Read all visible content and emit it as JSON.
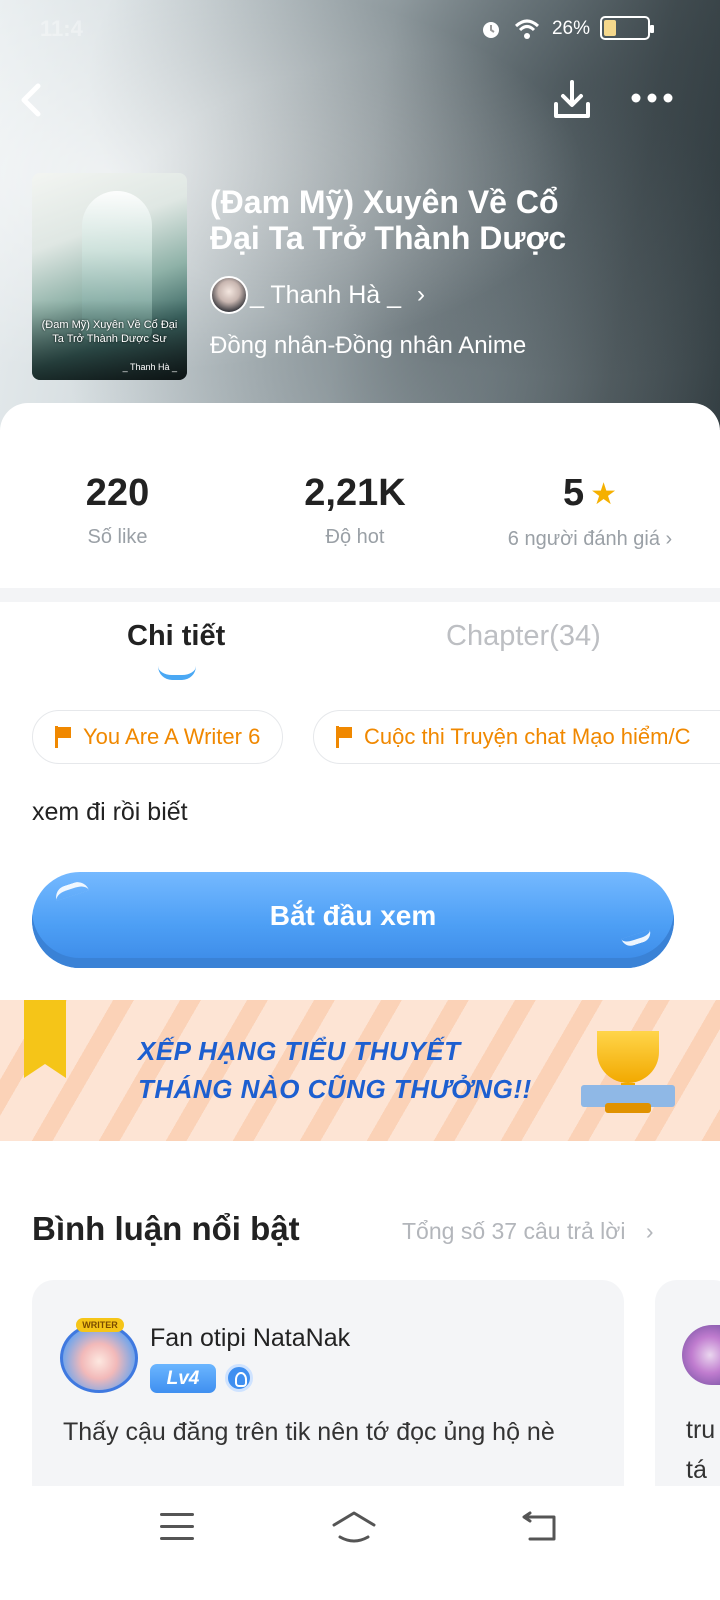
{
  "status_bar": {
    "time": "11:4",
    "battery": "26%"
  },
  "book": {
    "title": "(Đam Mỹ) Xuyên Về Cổ Đại Ta Trở Thành Dược",
    "author": "_ Thanh Hà _",
    "genre": "Đồng nhân-Đồng nhân Anime",
    "cover_title": "(Đam Mỹ) Xuyên Về Cổ Đại Ta Trở Thành Dược Sư",
    "cover_author": "_ Thanh Hà _"
  },
  "stats": {
    "likes_value": "220",
    "likes_label": "Số like",
    "hot_value": "2,21K",
    "hot_label": "Độ hot",
    "rating_value": "5",
    "rating_label": "6 người đánh giá",
    "rating_chevron": "›"
  },
  "tabs": {
    "detail": "Chi tiết",
    "chapter": "Chapter(34)"
  },
  "tags": [
    "You Are A Writer 6",
    "Cuộc thi Truyện chat Mạo hiểm/C"
  ],
  "description": "xem đi rồi biết",
  "start_button": "Bắt đầu xem",
  "banner": {
    "line1": "XẾP HẠNG TIỂU THUYẾT",
    "line2": "THÁNG NÀO CŨNG THƯỞNG!!"
  },
  "comments_section": {
    "title": "Bình luận nổi bật",
    "total": "Tổng số 37 câu trả lời",
    "chevron": "›"
  },
  "comment": {
    "author": "Fan otipi NataNak",
    "writer_badge": "WRITER",
    "level": "Lv4",
    "text": "Thấy cậu đăng trên tik nên tớ đọc ủng hộ nè"
  },
  "next_comment": {
    "line1": "tru",
    "line2": "tá"
  },
  "colors": {
    "accent": "#4aa8f4",
    "tag_orange": "#f08800",
    "star": "#f5b000",
    "banner_text": "#1d5fd0"
  }
}
